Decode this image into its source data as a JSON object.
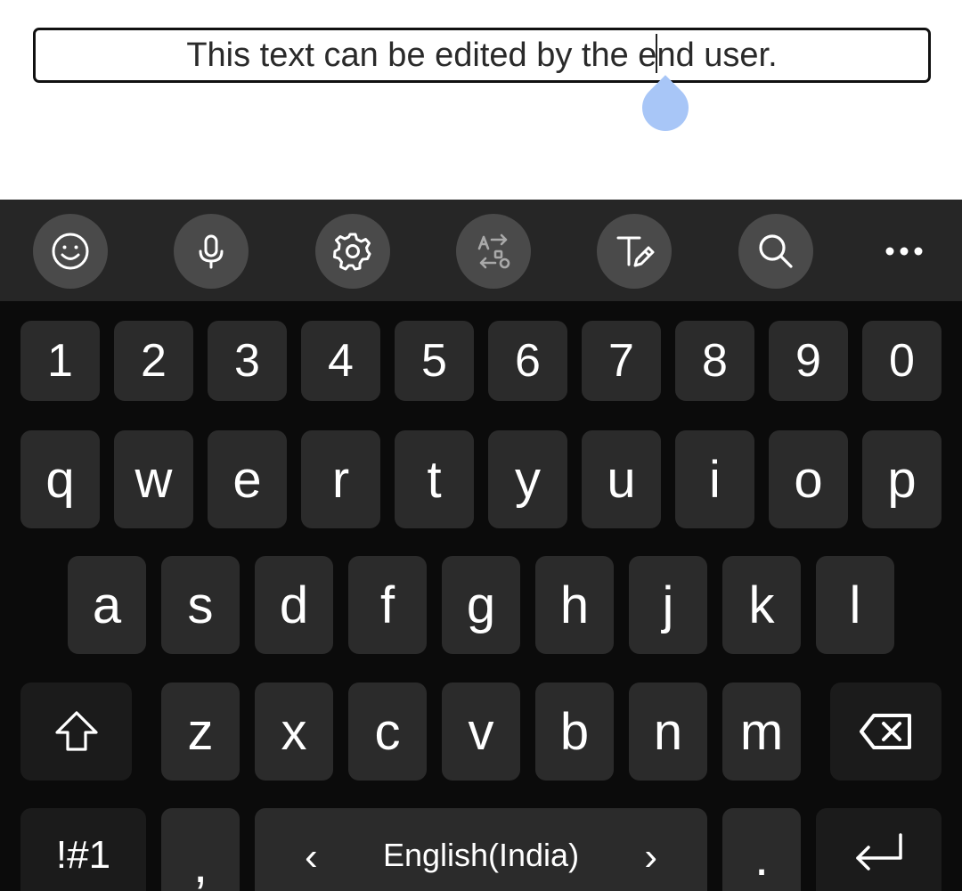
{
  "text_field": {
    "before_caret": "This text can be edited by the e",
    "after_caret": "nd user."
  },
  "toolbar": {
    "icons": [
      "emoji-icon",
      "microphone-icon",
      "settings-icon",
      "translate-icon",
      "handwriting-icon",
      "search-icon",
      "more-icon"
    ]
  },
  "keyboard": {
    "numbers": [
      "1",
      "2",
      "3",
      "4",
      "5",
      "6",
      "7",
      "8",
      "9",
      "0"
    ],
    "row1": [
      "q",
      "w",
      "e",
      "r",
      "t",
      "y",
      "u",
      "i",
      "o",
      "p"
    ],
    "row2": [
      "a",
      "s",
      "d",
      "f",
      "g",
      "h",
      "j",
      "k",
      "l"
    ],
    "row3": [
      "z",
      "x",
      "c",
      "v",
      "b",
      "n",
      "m"
    ],
    "symbols_label": "!#1",
    "comma_label": ",",
    "space_label": "English(India)",
    "period_label": ".",
    "prev_language_arrow": "‹",
    "next_language_arrow": "›"
  },
  "colors": {
    "keyboard_bg": "#0b0b0b",
    "toolbar_bg": "#262626",
    "key_bg": "#2b2b2b",
    "caret_handle": "#a8c6f7"
  }
}
